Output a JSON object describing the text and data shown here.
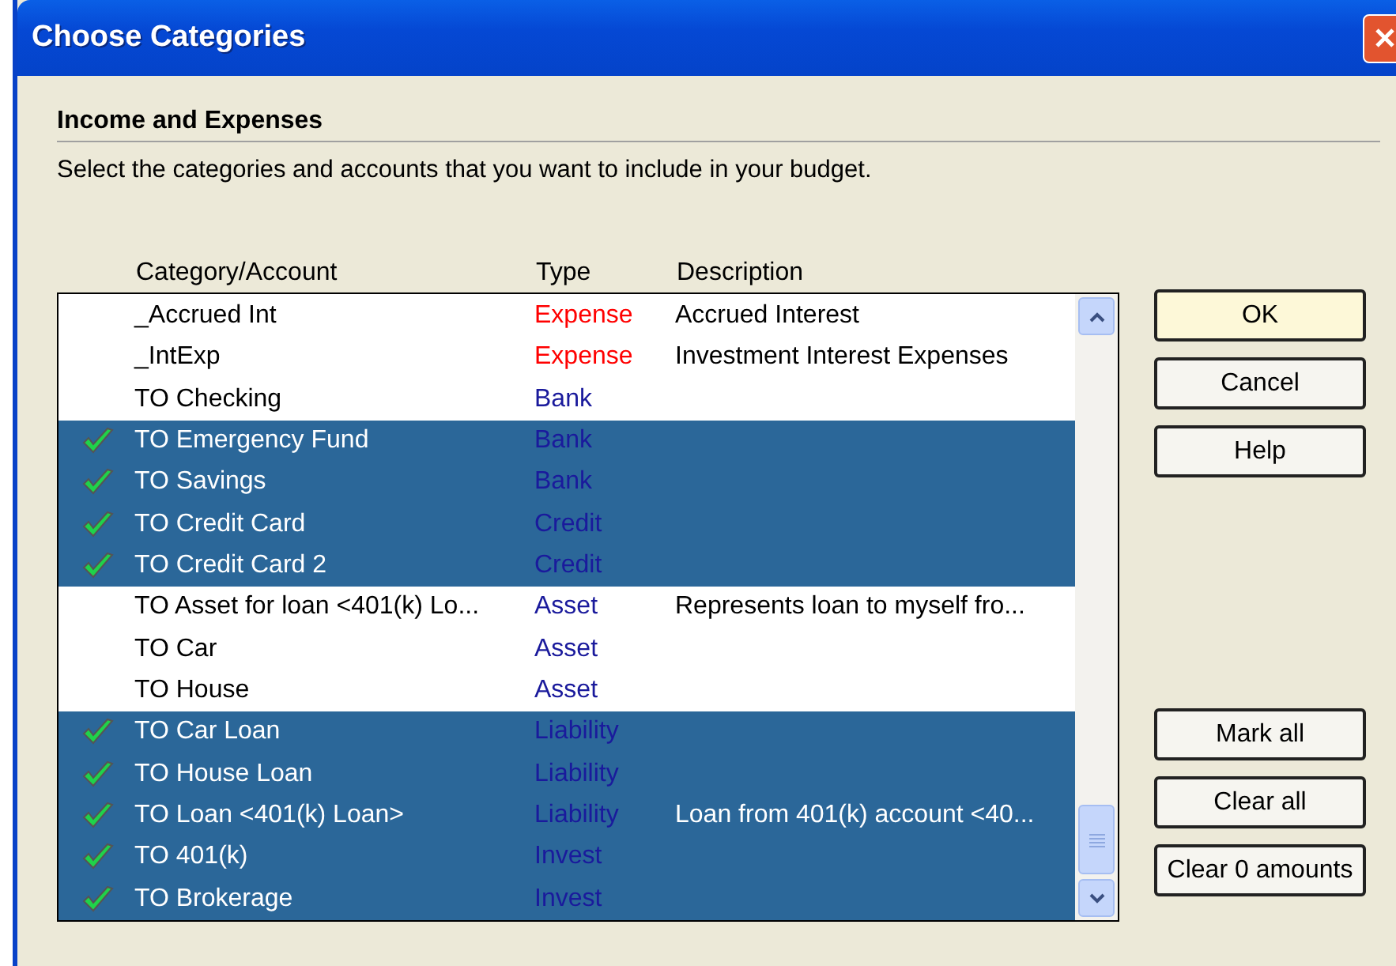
{
  "window": {
    "title": "Choose Categories"
  },
  "section": {
    "heading": "Income and Expenses",
    "instructions": "Select the categories and accounts that you want to include in your budget."
  },
  "table": {
    "columns": [
      "Category/Account",
      "Type",
      "Description"
    ],
    "rows": [
      {
        "name": "_Accrued Int",
        "type": "Expense",
        "color": "#ff0000",
        "description": "Accrued Interest",
        "selected": false
      },
      {
        "name": "_IntExp",
        "type": "Expense",
        "color": "#ff0000",
        "description": "Investment Interest Expenses",
        "selected": false
      },
      {
        "name": "TO Checking",
        "type": "Bank",
        "color": "#1a1a9c",
        "selected": false
      },
      {
        "name": "TO Emergency Fund",
        "type": "Bank",
        "color": "#1a1a9c",
        "selected": true
      },
      {
        "name": "TO Savings",
        "type": "Bank",
        "color": "#1a1a9c",
        "selected": true
      },
      {
        "name": "TO Credit Card",
        "type": "Credit",
        "color": "#1a1a9c",
        "selected": true
      },
      {
        "name": "TO Credit Card 2",
        "type": "Credit",
        "color": "#1a1a9c",
        "selected": true
      },
      {
        "name": "TO Asset for loan <401(k) Lo...",
        "type": "Asset",
        "color": "#1a1a9c",
        "description": "Represents loan to myself fro...",
        "selected": false
      },
      {
        "name": "TO Car",
        "type": "Asset",
        "color": "#1a1a9c",
        "selected": false
      },
      {
        "name": "TO House",
        "type": "Asset",
        "color": "#1a1a9c",
        "selected": false
      },
      {
        "name": "TO Car Loan",
        "type": "Liability",
        "color": "#1a1a9c",
        "selected": true
      },
      {
        "name": "TO House Loan",
        "type": "Liability",
        "color": "#1a1a9c",
        "selected": true
      },
      {
        "name": "TO Loan <401(k) Loan>",
        "type": "Liability",
        "color": "#1a1a9c",
        "description": "Loan from 401(k) account <40...",
        "selected": true
      },
      {
        "name": "TO 401(k)",
        "type": "Invest",
        "color": "#1a1a9c",
        "selected": true
      },
      {
        "name": "TO Brokerage",
        "type": "Invest",
        "color": "#1a1a9c",
        "selected": true
      }
    ]
  },
  "buttons_top": [
    {
      "label": "OK",
      "default": true
    },
    {
      "label": "Cancel",
      "default": false
    },
    {
      "label": "Help",
      "default": false
    }
  ],
  "buttons_bottom": [
    "Mark all",
    "Clear all",
    "Clear 0 amounts"
  ]
}
